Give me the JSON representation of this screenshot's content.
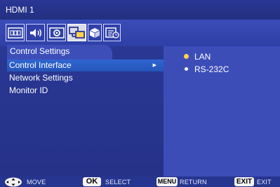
{
  "title": "HDMI 1",
  "tabs": [
    {
      "icon": "rgb-picture-icon",
      "active": false
    },
    {
      "icon": "speaker-sound-icon",
      "active": false
    },
    {
      "icon": "setup-gear-icon",
      "active": false
    },
    {
      "icon": "network-monitors-icon",
      "active": true
    },
    {
      "icon": "cube-icon",
      "active": false
    },
    {
      "icon": "schedule-list-icon",
      "active": false
    }
  ],
  "section_title": "Control Settings",
  "menu": [
    {
      "label": "Control Interface",
      "selected": true
    },
    {
      "label": "Network Settings",
      "selected": false
    },
    {
      "label": "Monitor ID",
      "selected": false
    }
  ],
  "options": [
    {
      "label": "LAN",
      "checked": true
    },
    {
      "label": "RS-232C",
      "checked": false
    }
  ],
  "footer": {
    "move_label": "MOVE",
    "ok_key": "OK",
    "select_label": "SELECT",
    "menu_key": "MENU",
    "return_label": "RETURN",
    "exit_key": "EXIT",
    "exit_label": "EXIT"
  },
  "colors": {
    "background": "#2f3fa8",
    "highlight": "#2f66d2",
    "radio_checked": "#ffd24a"
  }
}
